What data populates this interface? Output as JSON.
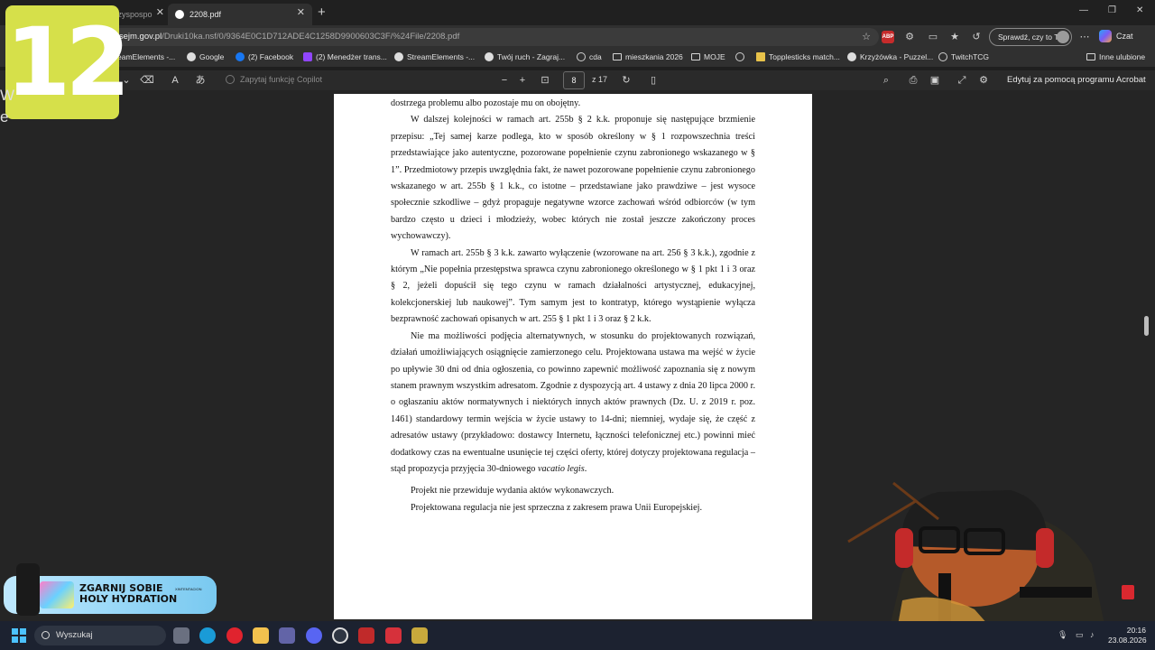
{
  "tabs": [
    {
      "label": "czyspospo",
      "active": false
    },
    {
      "label": "2208.pdf",
      "active": true
    }
  ],
  "address": {
    "host": "rka.sejm.gov.pl",
    "path": "/Druki10ka.nsf/0/9364E0C1D712ADE4C1258D9900603C3F/%24File/2208.pdf"
  },
  "profile_button": "Sprawdź, czy to Ty",
  "copilot_button": "Czat",
  "bookmarks": [
    "eamElements -...",
    "Google",
    "(2) Facebook",
    "(2) Menedżer trans...",
    "StreamElements -...",
    "Twój ruch - Zagraj...",
    "cda",
    "mieszkania 2026",
    "MOJE",
    "",
    "Topplesticks match...",
    "Krzyżówka - Puzzel...",
    "TwitchTCG"
  ],
  "bookmarks_other": "Inne ulubione",
  "pdf_toolbar": {
    "ask_copilot": "Zapytaj funkcję Copilot",
    "page_current": "8",
    "page_total": "z 17",
    "edit_label": "Edytuj za pomocą programu Acrobat"
  },
  "document": {
    "p0": "dostrzega problemu albo pozostaje mu on obojętny.",
    "p1": "W dalszej kolejności w ramach art. 255b § 2 k.k. proponuje się następujące brzmienie przepisu: „Tej samej karze podlega, kto w sposób określony w § 1 rozpowszechnia treści przedstawiające jako autentyczne, pozorowane popełnienie czynu zabronionego wskazanego w § 1”. Przedmiotowy przepis uwzględnia fakt, że nawet pozorowane popełnienie czynu zabronionego wskazanego w art. 255b § 1 k.k., co istotne – przedstawiane jako prawdziwe – jest wysoce społecznie szkodliwe – gdyż propaguje negatywne wzorce zachowań wśród odbiorców (w tym bardzo często u dzieci i młodzieży, wobec których nie został jeszcze zakończony proces wychowawczy).",
    "p2": "W ramach art. 255b § 3 k.k. zawarto wyłączenie (wzorowane na art. 256 § 3 k.k.), zgodnie z którym „Nie popełnia przestępstwa sprawca czynu zabronionego określonego w § 1 pkt 1 i 3 oraz § 2, jeżeli dopuścił się tego czynu w ramach działalności artystycznej, edukacyjnej, kolekcjonerskiej lub naukowej”. Tym samym jest to kontratyp, którego wystąpienie wyłącza bezprawność zachowań opisanych w art. 255 § 1 pkt 1 i 3 oraz § 2 k.k.",
    "p3_main": "Nie ma możliwości podjęcia alternatywnych, w stosunku do projektowanych rozwiązań, działań umożliwiających osiągnięcie zamierzonego celu. Projektowana ustawa ma wejść w życie po upływie 30 dni od dnia ogłoszenia, co powinno zapewnić możliwość zapoznania się z nowym stanem prawnym wszystkim adresatom. Zgodnie z dyspozycją art. 4 ustawy z dnia 20 lipca 2000 r. o ogłaszaniu aktów normatywnych i niektórych innych aktów prawnych (Dz. U. z 2019 r. poz. 1461) standardowy termin wejścia w życie ustawy to 14-dni; niemniej, wydaje się, że część z adresatów ustawy (przykładowo: dostawcy Internetu, łączności telefonicznej etc.) powinni mieć dodatkowy czas na ewentualne usunięcie tej części oferty, której dotyczy projektowana regulacja – stąd propozycja przyjęcia 30-dniowego ",
    "p3_italic": "vacatio legis",
    "p3_end": ".",
    "p4": "Projekt nie przewiduje wydania aktów wykonawczych.",
    "p5": "Projektowana regulacja nie jest sprzeczna z zakresem prawa Unii Europejskiej."
  },
  "overlay": {
    "badge_number": "12",
    "left_edge_text": "W\ne",
    "promo_line1": "ZGARNIJ SOBIE",
    "promo_line2": "HOLY HYDRATION",
    "promo_small": "XINTENTACION"
  },
  "taskbar": {
    "search_placeholder": "Wyszukaj",
    "time": "20:16",
    "date": "23.08.2026"
  }
}
